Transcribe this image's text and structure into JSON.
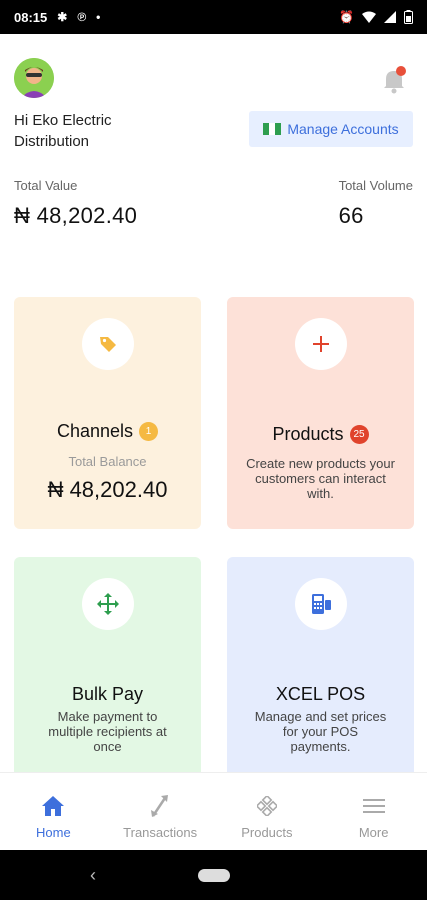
{
  "status_bar": {
    "time": "08:15",
    "notification_icons": [
      "slack-icon",
      "pinterest-icon",
      "dot-icon"
    ],
    "system_icons": [
      "alarm-icon",
      "wifi-icon",
      "signal-icon",
      "battery-icon"
    ]
  },
  "header": {
    "greeting": "Hi Eko Electric Distribution",
    "manage_accounts_label": "Manage Accounts",
    "notification_dot_color": "#e8503a"
  },
  "stats": {
    "total_value_label": "Total Value",
    "total_value": "₦ 48,202.40",
    "total_volume_label": "Total Volume",
    "total_volume": "66"
  },
  "cards": {
    "channels": {
      "title": "Channels",
      "badge": "1",
      "sub_label": "Total Balance",
      "balance": "₦ 48,202.40",
      "color": "#fdf1de",
      "icon": "tag-icon"
    },
    "products": {
      "title": "Products",
      "badge": "25",
      "description": "Create new products your customers can interact with.",
      "color": "#fde1d8",
      "icon": "plus-icon"
    },
    "bulk_pay": {
      "title": "Bulk Pay",
      "description": "Make payment to multiple recipients at once",
      "color": "#e3f8e4",
      "icon": "move-arrows-icon"
    },
    "xcel_pos": {
      "title": "XCEL POS",
      "description": "Manage and set prices for your POS payments.",
      "color": "#e5ecfd",
      "icon": "pos-terminal-icon"
    }
  },
  "bottom_nav": {
    "items": [
      {
        "label": "Home",
        "icon": "home-icon",
        "active": true
      },
      {
        "label": "Transactions",
        "icon": "transactions-icon",
        "active": false
      },
      {
        "label": "Products",
        "icon": "products-icon",
        "active": false
      },
      {
        "label": "More",
        "icon": "menu-icon",
        "active": false
      }
    ]
  },
  "colors": {
    "accent": "#3d6fdc",
    "badge_yellow": "#f5b942",
    "badge_red": "#e0432c"
  }
}
